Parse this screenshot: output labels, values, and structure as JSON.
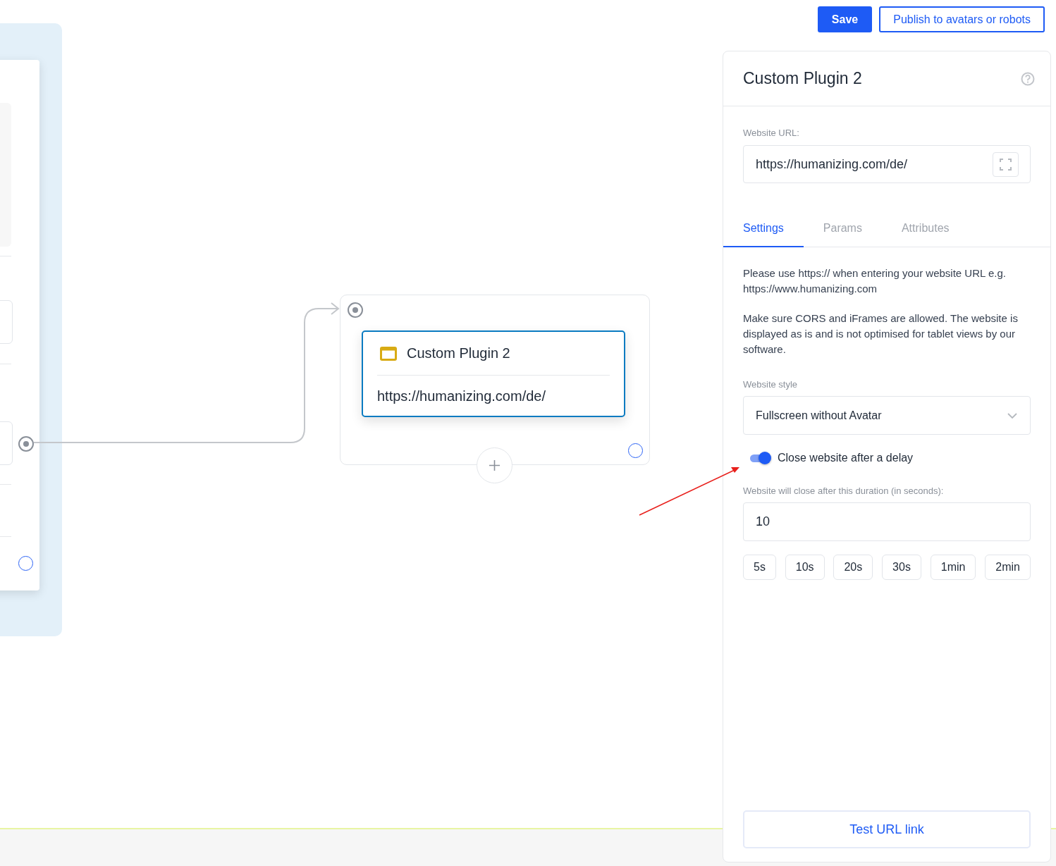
{
  "toolbar": {
    "buttons": [
      {
        "label": "Save",
        "kind": "primary"
      },
      {
        "label": "Publish to avatars or robots",
        "kind": "outline"
      }
    ]
  },
  "canvas": {
    "node": {
      "title": "Custom Plugin 2",
      "url": "https://humanizing.com/de/",
      "selected": true
    }
  },
  "panel": {
    "title": "Custom Plugin 2",
    "url_label": "Website URL:",
    "url_value": "https://humanizing.com/de/",
    "tabs": [
      {
        "label": "Settings",
        "selected": true
      },
      {
        "label": "Params",
        "selected": false
      },
      {
        "label": "Attributes",
        "selected": false
      }
    ],
    "notes": [
      "Please use https:// when entering your website URL e.g. https://www.humanizing.com",
      "Make sure CORS and iFrames are allowed. The website is displayed as is and is not optimised for tablet views by our software."
    ],
    "style_label": "Website style",
    "style_value": "Fullscreen without Avatar",
    "close_toggle": {
      "label": "Close website after a delay",
      "on": true
    },
    "duration_label": "Website will close after this duration (in seconds):",
    "duration_value": "10",
    "presets": [
      "5s",
      "10s",
      "20s",
      "30s",
      "1min",
      "2min"
    ],
    "test_button": "Test URL link"
  }
}
